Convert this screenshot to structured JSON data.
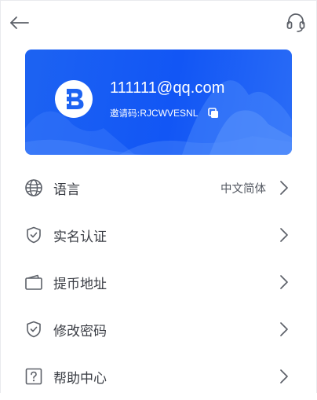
{
  "header": {
    "back_icon": "arrow-left-icon",
    "support_icon": "headset-icon"
  },
  "user_card": {
    "logo_icon": "brand-b-logo",
    "email": "111111@qq.com",
    "invite_label": "邀请码:",
    "invite_code": "RJCWVESNL",
    "copy_icon": "copy-icon",
    "colors": {
      "card_start": "#1d63f2",
      "card_end": "#2a6cf6",
      "text": "#ffffff"
    }
  },
  "menu": {
    "items": [
      {
        "label": "语言",
        "value": "中文简体",
        "icon": "globe-icon"
      },
      {
        "label": "实名认证",
        "value": "",
        "icon": "shield-check-icon"
      },
      {
        "label": "提币地址",
        "value": "",
        "icon": "wallet-icon"
      },
      {
        "label": "修改密码",
        "value": "",
        "icon": "shield-check-icon"
      },
      {
        "label": "帮助中心",
        "value": "",
        "icon": "help-icon"
      }
    ]
  },
  "colors": {
    "icon": "#5c6068",
    "label": "#3a3d44",
    "chevron": "#5c6068"
  }
}
